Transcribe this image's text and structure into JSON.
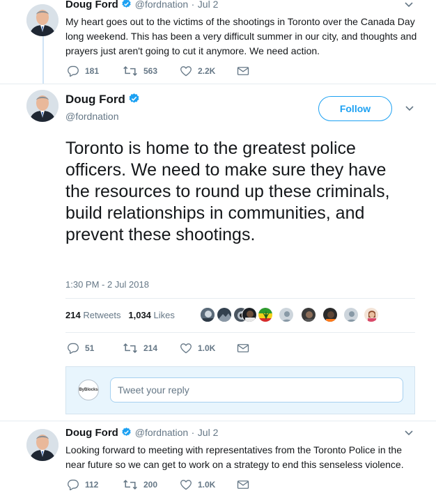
{
  "tweet1": {
    "name": "Doug Ford",
    "handle": "@fordnation",
    "date": "Jul 2",
    "text": "My heart goes out to the victims of the shootings in Toronto over the Canada Day long weekend. This has been a very difficult summer in our city, and thoughts and prayers just aren't going to cut it anymore. We need action.",
    "replies": "181",
    "retweets": "563",
    "likes": "2.2K"
  },
  "main": {
    "name": "Doug Ford",
    "handle": "@fordnation",
    "follow_label": "Follow",
    "text": "Toronto is home to the greatest police officers. We need to make sure they have the resources to round up these criminals, build relationships in communities, and prevent these shootings.",
    "timestamp": "1:30 PM - 2 Jul 2018",
    "retweet_count": "214",
    "retweet_label": "Retweets",
    "like_count": "1,034",
    "like_label": "Likes",
    "replies": "51",
    "retweets": "214",
    "likes": "1.0K"
  },
  "reply_box": {
    "avatar_text": "ByBlocks",
    "placeholder": "Tweet your reply"
  },
  "tweet3": {
    "name": "Doug Ford",
    "handle": "@fordnation",
    "date": "Jul 2",
    "text": "Looking forward to meeting with representatives from the Toronto Police in the near future so we can get to work on a strategy to end this senseless violence.",
    "replies": "112",
    "retweets": "200",
    "likes": "1.0K"
  },
  "icons": [
    "reply-icon",
    "retweet-icon",
    "like-icon",
    "dm-icon",
    "verified-icon",
    "chevron-down-icon"
  ],
  "colors": {
    "accent": "#1da1f2",
    "muted": "#657786",
    "thread": "#cfe3f5",
    "reply_bg": "#e8f5fd"
  }
}
